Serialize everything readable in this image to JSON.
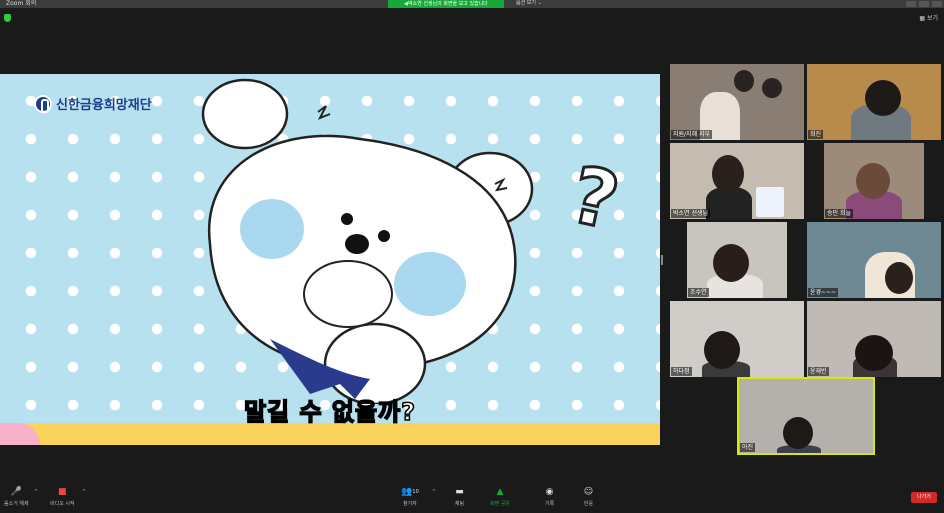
{
  "window": {
    "app_title": "Zoom 회의",
    "share_banner": "◀박소연 선생님의 화면을 보고 있습니다",
    "view_options": "옵션 보기 ⌄"
  },
  "view_toggle": "▦ 보기",
  "shared_screen": {
    "logo_text": "신한금융희망재단",
    "question_mark": "?",
    "subtitle": "말길 수 없을까?"
  },
  "participants": [
    {
      "name": "지원/지혜 지우",
      "bg": "#8a7e74"
    },
    {
      "name": "희진",
      "bg": "#b88a4c"
    },
    {
      "name": "박소연 선생님",
      "bg": "#c4bcb0"
    },
    {
      "name": "승민 희늘",
      "bg": "#9c8a7a"
    },
    {
      "name": "조수연",
      "bg": "#c8c4be"
    },
    {
      "name": "윤경~~~",
      "bg": "#6e8894"
    },
    {
      "name": "",
      "bg": "#d8d4d0"
    },
    {
      "name": "",
      "bg": "#b8a898"
    },
    {
      "name": "하다정",
      "bg": "#d0ccc8"
    },
    {
      "name": "윤재빈",
      "bg": "#c0bab4"
    },
    {
      "name": "아진",
      "bg": "#b4b0ac"
    }
  ],
  "toolbar": {
    "mute_label": "음소거 해제",
    "video_label": "비디오 시작",
    "participants_label": "참가자",
    "participants_count": "10",
    "chat_label": "채팅",
    "share_label": "화면 공유",
    "record_label": "기록",
    "reactions_label": "반응",
    "leave_label": "나가기"
  },
  "colors": {
    "share_accent": "#18a83a",
    "leave": "#d12a2a",
    "active_speaker": "#d8e80a"
  }
}
